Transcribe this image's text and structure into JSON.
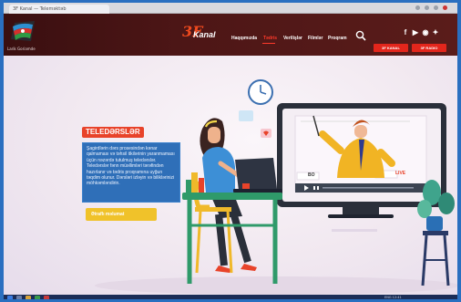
{
  "browser": {
    "tab_title": "3F Kanal — Teleməktəb"
  },
  "header": {
    "logo_caption": "Larik Goriamde",
    "brand": {
      "mark": "3F",
      "name": "Kanal"
    },
    "nav": [
      "Haqqımızda",
      "Tədris",
      "Verilişlər",
      "Filmlər",
      "Proqram"
    ],
    "active_nav_index": 1,
    "social_icons": [
      "facebook-icon",
      "youtube-icon",
      "instagram-icon",
      "twitter-icon"
    ],
    "buttons": [
      "3F KANAL",
      "3F RADIO"
    ]
  },
  "hero": {
    "title": "TELEDƏRSLƏR",
    "description": "Şagirdlərin dərs prosesindən kənar qalmaması və təhsil itkilərinin yaranmaması üçün nəzərdə tutulmuş teledərslər. Teledərslər fənn müəllimləri tərəfindən hazırlanır və tədris proqramına uyğun təqdim olunur. Dərsləri izləyin və biliklərinizi möhkəmləndirin.",
    "more_button": "Ətraflı məlumat",
    "video_card": {
      "left_label": "BO",
      "right_label": "LIVE"
    }
  },
  "taskbar": {
    "tray_text": "ENG  12:41"
  },
  "colors": {
    "accent": "#e3261c",
    "header_bg": "#4d1616",
    "desc_bg": "#2f6fb8",
    "button_yellow": "#f0c22a"
  }
}
